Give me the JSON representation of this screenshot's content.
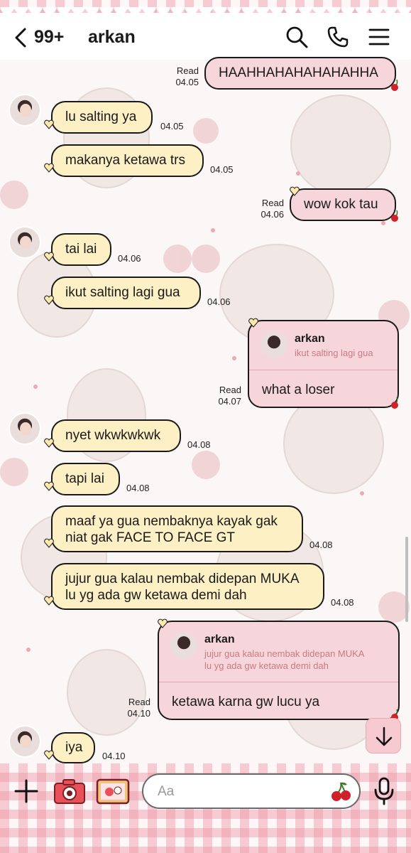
{
  "header": {
    "unread_count": "99+",
    "contact_name": "arkan",
    "icons": [
      "back-icon",
      "search-icon",
      "phone-icon",
      "menu-icon"
    ]
  },
  "messages": [
    {
      "id": "m1",
      "side": "out",
      "text": "HAAHHAHAHAHAHAHHA",
      "status": "Read",
      "time": "04.05"
    },
    {
      "id": "m2",
      "side": "in",
      "text": "lu salting ya",
      "time": "04.05"
    },
    {
      "id": "m3",
      "side": "in",
      "text": "makanya ketawa trs",
      "time": "04.05"
    },
    {
      "id": "m4",
      "side": "out",
      "text": "wow kok tau",
      "status": "Read",
      "time": "04.06"
    },
    {
      "id": "m5",
      "side": "in",
      "text": "tai lai",
      "time": "04.06"
    },
    {
      "id": "m6",
      "side": "in",
      "text": "ikut salting lagi gua",
      "time": "04.06"
    },
    {
      "id": "m7",
      "side": "out",
      "reply_name": "arkan",
      "reply_quote": "ikut salting lagi gua",
      "text": "what a loser",
      "status": "Read",
      "time": "04.07"
    },
    {
      "id": "m8",
      "side": "in",
      "text": "nyet wkwkwkwk",
      "time": "04.08"
    },
    {
      "id": "m9",
      "side": "in",
      "text": "tapi lai",
      "time": "04.08"
    },
    {
      "id": "m10",
      "side": "in",
      "line1": "maaf ya gua nembaknya kayak gak",
      "line2": "niat gak FACE TO FACE GT",
      "time": "04.08"
    },
    {
      "id": "m11",
      "side": "in",
      "line1": "jujur gua kalau nembak didepan MUKA",
      "line2": "lu yg ada gw ketawa demi dah",
      "time": "04.08"
    },
    {
      "id": "m12",
      "side": "out",
      "reply_name": "arkan",
      "reply_quote1": "jujur gua kalau nembak didepan MUKA",
      "reply_quote2": "lu yg ada gw ketawa demi dah",
      "text": "ketawa karna gw lucu ya",
      "status": "Read",
      "time": "04.10"
    },
    {
      "id": "m13",
      "side": "in",
      "text": "iya",
      "time": "04.10"
    }
  ],
  "composer": {
    "placeholder": "Aa",
    "icons": [
      "plus-icon",
      "camera-icon",
      "photo-icon",
      "cherry-icon",
      "microphone-icon"
    ]
  },
  "colors": {
    "incoming_bubble": "#fdf0c4",
    "outgoing_bubble": "#f7d6db",
    "gingham_pink": "#ec96a5",
    "accent_red": "#d0202a"
  }
}
